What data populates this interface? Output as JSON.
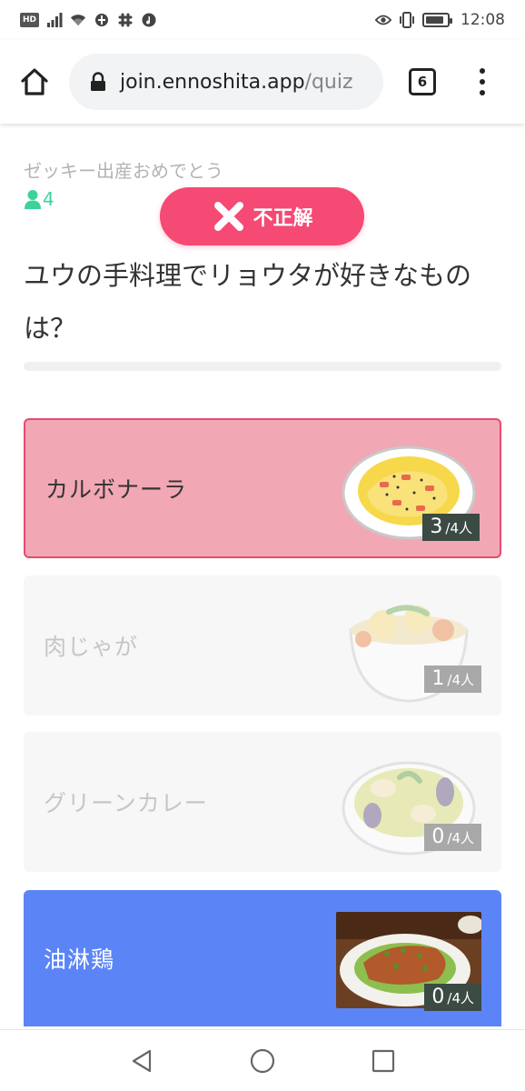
{
  "status_bar": {
    "hd_label": "HD",
    "time": "12:08",
    "battery_level": 0.85,
    "icons": [
      "signal-icon",
      "wifi-icon",
      "app-notification-icon",
      "slack-icon",
      "music-icon",
      "eye-comfort-icon",
      "vibrate-icon",
      "battery-icon"
    ]
  },
  "browser": {
    "url_domain": "join.ennoshita.app",
    "url_path": "/quiz",
    "tab_count": "6"
  },
  "quiz": {
    "event_title": "ゼッキー出産おめでとう",
    "participant_count": "4",
    "result_label": "不正解",
    "question": "ユウの手料理でリョウタが好きなものは？",
    "choices": [
      {
        "label": "カルボナーラ",
        "count": "3",
        "total": "/4人",
        "state": "selected-wrong"
      },
      {
        "label": "肉じゃが",
        "count": "1",
        "total": "/4人",
        "state": "dim"
      },
      {
        "label": "グリーンカレー",
        "count": "0",
        "total": "/4人",
        "state": "dim"
      },
      {
        "label": "油淋鶏",
        "count": "0",
        "total": "/4人",
        "state": "correct"
      }
    ]
  },
  "colors": {
    "wrong": "#f54a73",
    "selected_bg": "#f2a7b4",
    "correct_bg": "#5b85f7",
    "participant": "#3dd29b"
  }
}
